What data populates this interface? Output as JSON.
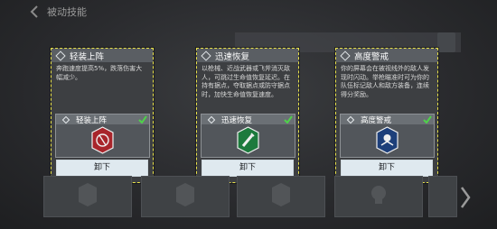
{
  "header": {
    "title": "被动技能"
  },
  "cards": [
    {
      "name": "轻装上阵",
      "description": "奔跑速度提高5%，跌落伤害大幅减少。",
      "slot_label": "轻装上阵",
      "button": "卸下",
      "badge_color": "#a8252b",
      "badge_icon": "no-armor-icon"
    },
    {
      "name": "迅速恢复",
      "description": "以枪械、近战武器或飞斧消灭敌人，可跳过生命值恢复延迟。在持有据点，夺取据点或防守据点时，加快生命值恢复速度。",
      "slot_label": "迅速恢复",
      "button": "卸下",
      "badge_color": "#1d7a3d",
      "badge_icon": "syringe-icon"
    },
    {
      "name": "高度警戒",
      "description": "你的屏幕会在被视线外的敌人发现时闪动。举枪瞄准时可为你的队伍标记敌人和敌方装备，连续得分奖励。",
      "slot_label": "高度警戒",
      "button": "卸下",
      "badge_color": "#1d3f7a",
      "badge_icon": "alert-eye-icon"
    }
  ]
}
